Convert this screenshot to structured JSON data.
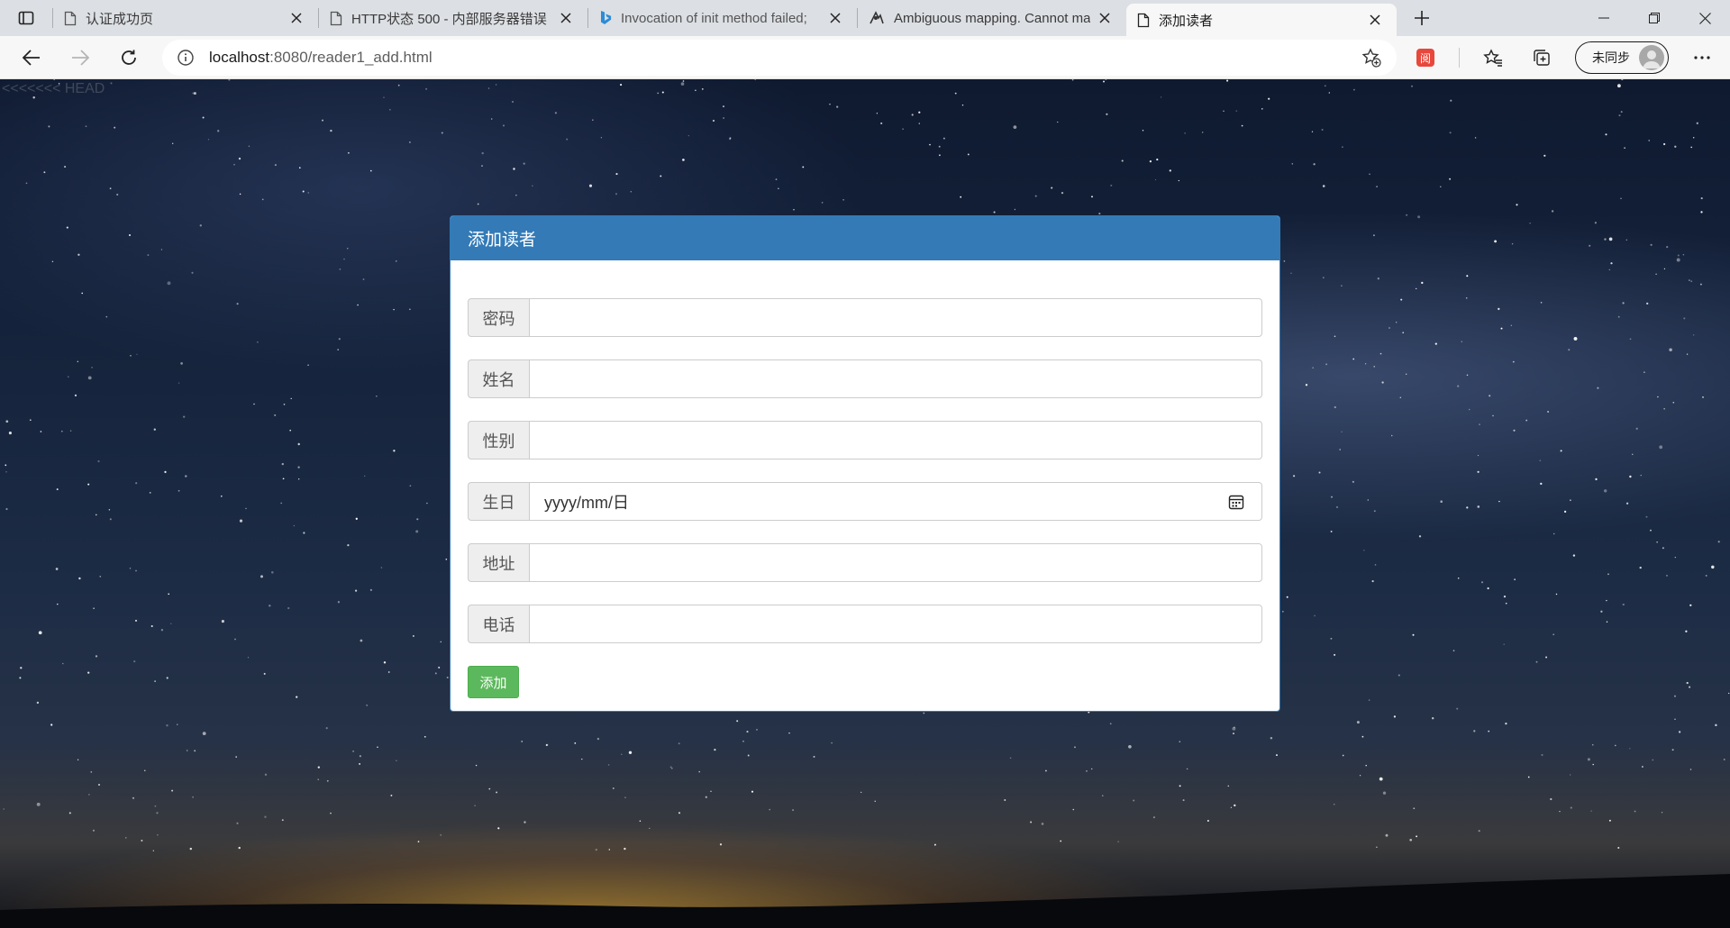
{
  "tabs": [
    {
      "title": "认证成功页",
      "icon": "page-icon",
      "active": false
    },
    {
      "title": "HTTP状态 500 - 内部服务器错误",
      "icon": "page-icon",
      "active": false
    },
    {
      "title": "Invocation of init method failed;",
      "icon": "bing-icon",
      "active": false
    },
    {
      "title": "Ambiguous mapping. Cannot ma",
      "icon": "app-icon",
      "active": false
    },
    {
      "title": "添加读者",
      "icon": "page-icon",
      "active": true
    }
  ],
  "address_bar": {
    "host": "localhost",
    "path": ":8080/reader1_add.html"
  },
  "profile": {
    "label": "未同步"
  },
  "extension": {
    "label": "阅"
  },
  "page": {
    "git_marker": "<<<<<<< HEAD",
    "panel_title": "添加读者",
    "fields": [
      {
        "label": "密码",
        "value": ""
      },
      {
        "label": "姓名",
        "value": ""
      },
      {
        "label": "性别",
        "value": ""
      },
      {
        "label": "生日",
        "value": "yyyy/mm/日"
      },
      {
        "label": "地址",
        "value": ""
      },
      {
        "label": "电话",
        "value": ""
      }
    ],
    "submit_label": "添加"
  },
  "colors": {
    "panel_header": "#337ab7",
    "button_green": "#5cb85c",
    "addon_bg": "#eeeeee"
  }
}
